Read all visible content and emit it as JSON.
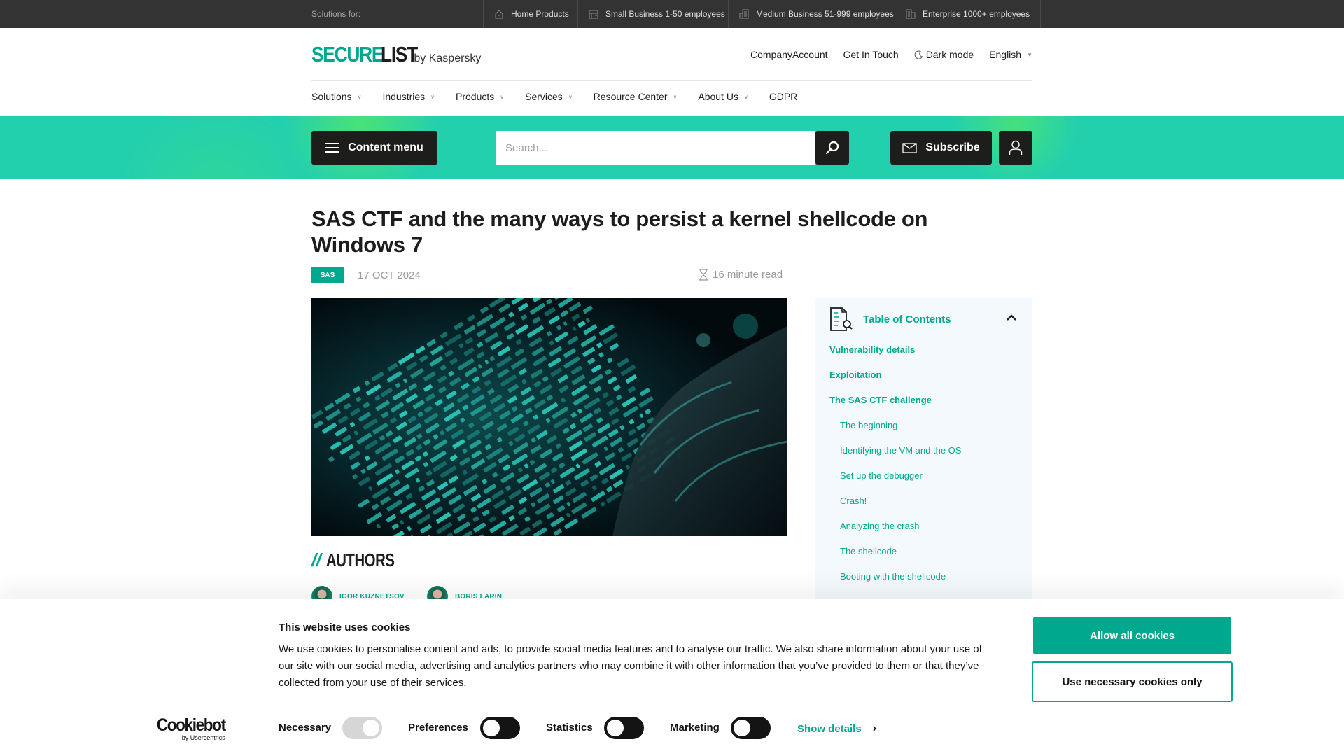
{
  "topbar": {
    "label": "Solutions for:",
    "segments": [
      {
        "icon": "home-icon",
        "label": "Home Products"
      },
      {
        "icon": "small-business-icon",
        "label": "Small Business 1-50 employees"
      },
      {
        "icon": "medium-business-icon",
        "label": "Medium Business 51-999 employees"
      },
      {
        "icon": "enterprise-icon",
        "label": "Enterprise 1000+ employees"
      }
    ]
  },
  "header": {
    "logo_primary": "SECURE",
    "logo_secondary": "LIST",
    "logo_by": "by Kaspersky",
    "links": {
      "company_account": "CompanyAccount",
      "get_in_touch": "Get In Touch",
      "dark_mode": "Dark mode",
      "language": "English"
    }
  },
  "nav": {
    "items": [
      {
        "label": "Solutions",
        "dropdown": true
      },
      {
        "label": "Industries",
        "dropdown": true
      },
      {
        "label": "Products",
        "dropdown": true
      },
      {
        "label": "Services",
        "dropdown": true
      },
      {
        "label": "Resource Center",
        "dropdown": true
      },
      {
        "label": "About Us",
        "dropdown": true
      },
      {
        "label": "GDPR",
        "dropdown": false
      }
    ]
  },
  "band": {
    "content_menu": "Content menu",
    "search_placeholder": "Search...",
    "subscribe": "Subscribe"
  },
  "article": {
    "title": "SAS CTF and the many ways to persist a kernel shellcode on Windows 7",
    "tag": "SAS",
    "date": "17 OCT 2024",
    "read_time": "16 minute read",
    "authors_heading": "AUTHORS",
    "authors_slashes": "//",
    "authors": [
      {
        "name": "IGOR KUZNETSOV"
      },
      {
        "name": "BORIS LARIN"
      }
    ]
  },
  "toc": {
    "title": "Table of Contents",
    "expanded": true,
    "items": [
      {
        "label": "Vulnerability details",
        "level": 1
      },
      {
        "label": "Exploitation",
        "level": 1
      },
      {
        "label": "The SAS CTF challenge",
        "level": 1
      },
      {
        "label": "The beginning",
        "level": 2
      },
      {
        "label": "Identifying the VM and the OS",
        "level": 2
      },
      {
        "label": "Set up the debugger",
        "level": 2
      },
      {
        "label": "Crash!",
        "level": 2
      },
      {
        "label": "Analyzing the crash",
        "level": 2
      },
      {
        "label": "The shellcode",
        "level": 2
      },
      {
        "label": "Booting with the shellcode",
        "level": 2
      }
    ]
  },
  "cookie": {
    "title": "This website uses cookies",
    "text": "We use cookies to personalise content and ads, to provide social media features and to analyse our traffic. We also share information about your use of our site with our social media, advertising and analytics partners who may combine it with other information that you’ve provided to them or that they’ve collected from your use of their services.",
    "logo": "Cookiebot",
    "logo_sub": "by Usercentrics",
    "toggles": [
      {
        "label": "Necessary",
        "checked": true,
        "disabled": true
      },
      {
        "label": "Preferences",
        "checked": false,
        "disabled": false
      },
      {
        "label": "Statistics",
        "checked": false,
        "disabled": false
      },
      {
        "label": "Marketing",
        "checked": false,
        "disabled": false
      }
    ],
    "show_details": "Show details",
    "allow_all": "Allow all cookies",
    "necessary_only": "Use necessary cookies only"
  },
  "colors": {
    "brand_teal": "#00a88e",
    "band_teal": "#23d0ae",
    "dark": "#1d1d1b",
    "topbar_bg": "#333333",
    "toc_bg": "#f3f9fc"
  }
}
